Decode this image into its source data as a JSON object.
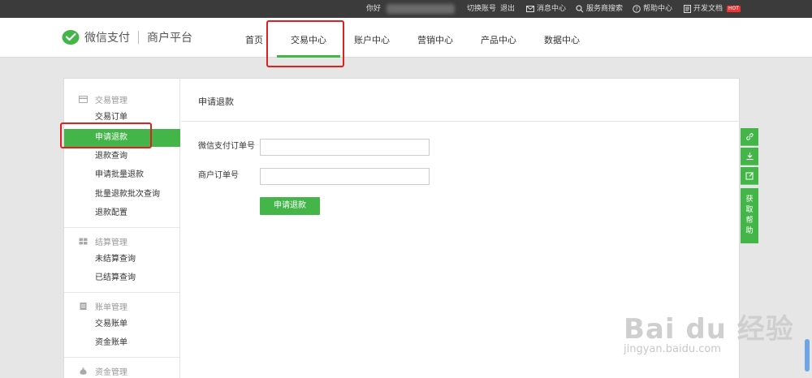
{
  "topbar": {
    "greeting": "你好",
    "switch_account": "切换账号",
    "logout": "退出",
    "messages": "消息中心",
    "service_search": "服务商搜索",
    "help": "帮助中心",
    "dev_docs": "开发文档",
    "hot_badge": "HOT"
  },
  "header": {
    "brand": "微信支付",
    "sub_brand": "商户平台",
    "nav": [
      "首页",
      "交易中心",
      "账户中心",
      "营销中心",
      "产品中心",
      "数据中心"
    ],
    "active_nav": "交易中心"
  },
  "sidebar": {
    "groups": [
      {
        "title": "交易管理",
        "icon": "card-icon",
        "items": [
          "交易订单",
          "申请退款",
          "退款查询",
          "申请批量退款",
          "批量退款批次查询",
          "退款配置"
        ]
      },
      {
        "title": "结算管理",
        "icon": "grid-icon",
        "items": [
          "未结算查询",
          "已结算查询"
        ]
      },
      {
        "title": "账单管理",
        "icon": "bill-icon",
        "items": [
          "交易账单",
          "资金账单"
        ]
      },
      {
        "title": "资金管理",
        "icon": "money-bag-icon",
        "items": []
      }
    ],
    "active_item": "申请退款"
  },
  "content": {
    "title": "申请退款",
    "wechat_order_label": "微信支付订单号",
    "wechat_order_value": "",
    "merchant_order_label": "商户订单号",
    "merchant_order_value": "",
    "submit_label": "申请退款"
  },
  "tools": {
    "help_tab": [
      "获",
      "取",
      "帮",
      "助"
    ]
  },
  "watermark": {
    "main": "Bai du 经验",
    "sub": "jingyan.baidu.com"
  },
  "colors": {
    "accent": "#44b549",
    "topbar": "#3b3b3b",
    "highlight": "#e02020"
  }
}
